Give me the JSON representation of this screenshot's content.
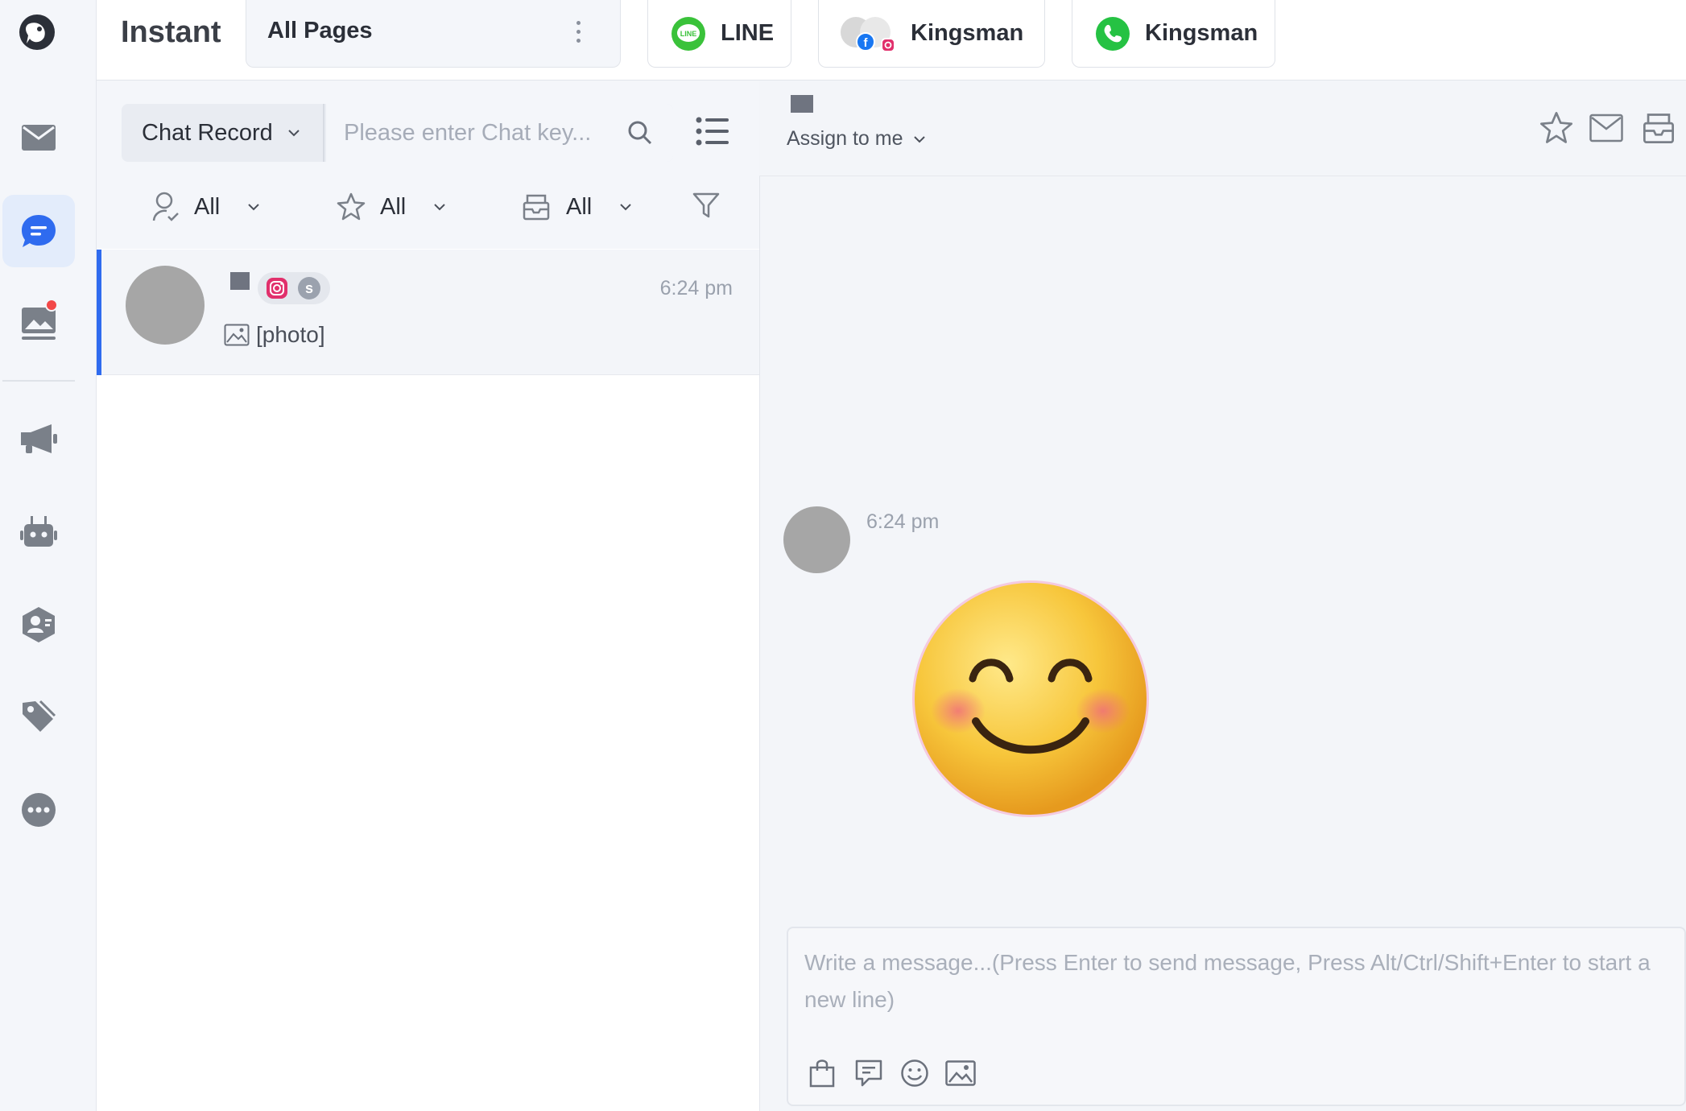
{
  "app": {
    "title": "Instant"
  },
  "header": {
    "pages_select": "All Pages",
    "tabs": [
      {
        "label": "LINE",
        "icon": "line-icon"
      },
      {
        "label": "Kingsman",
        "icon": "facebook-instagram-icon"
      },
      {
        "label": "Kingsman",
        "icon": "whatsapp-icon"
      }
    ]
  },
  "sidebar": {
    "items": [
      {
        "name": "inbox",
        "icon": "mail-icon"
      },
      {
        "name": "chat",
        "icon": "chat-bubble-icon",
        "active": true
      },
      {
        "name": "posts",
        "icon": "image-stack-icon",
        "notification": true
      },
      {
        "name": "broadcast",
        "icon": "megaphone-icon"
      },
      {
        "name": "bot",
        "icon": "robot-icon"
      },
      {
        "name": "contacts",
        "icon": "contact-icon"
      },
      {
        "name": "tags",
        "icon": "tag-icon"
      },
      {
        "name": "more",
        "icon": "more-icon"
      }
    ]
  },
  "list": {
    "search_type": "Chat Record",
    "search_placeholder": "Please enter Chat key...",
    "filters": [
      {
        "icon": "assignee-icon",
        "value": "All"
      },
      {
        "icon": "star-icon",
        "value": "All"
      },
      {
        "icon": "inbox-icon",
        "value": "All"
      }
    ],
    "conversations": [
      {
        "time": "6:24 pm",
        "preview": "[photo]",
        "channel_badge_letter": "s"
      }
    ]
  },
  "chat": {
    "assign_label": "Assign to me",
    "messages": [
      {
        "time": "6:24 pm",
        "type": "sticker",
        "sticker": "smiling-face-emoji"
      }
    ],
    "composer_placeholder": "Write a message...(Press Enter to send message, Press Alt/Ctrl/Shift+Enter to start a new line)"
  },
  "colors": {
    "accent": "#2f6bef",
    "line_green": "#3ac23a",
    "whatsapp_green": "#25c243",
    "notification": "#f24848"
  }
}
